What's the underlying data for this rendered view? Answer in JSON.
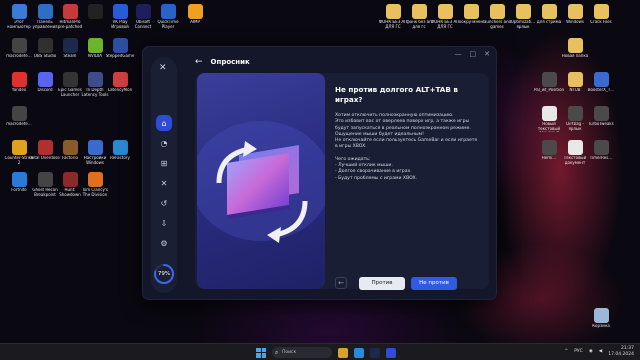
{
  "desktop": {
    "icons_left": [
      {
        "label": "Этот компьютер",
        "color": "#3b7bd8"
      },
      {
        "label": "Панель управления",
        "color": "#2d6fc4"
      },
      {
        "label": "HitmanPro pre-patched",
        "color": "#c83a3a"
      },
      {
        "label": "",
        "color": "#222"
      },
      {
        "label": "VK Play Игровой",
        "color": "#2a5bd7"
      },
      {
        "label": "Ubisoft Connect",
        "color": "#1e1e5a"
      },
      {
        "label": "QuickTime Player",
        "color": "#2a62c8"
      },
      {
        "label": "AIMP",
        "color": "#f0a020"
      },
      {
        "label": "macrodefe…",
        "color": "#444"
      },
      {
        "label": "OBS Studio",
        "color": "#303030"
      },
      {
        "label": "Steam",
        "color": "#1b2a4a"
      },
      {
        "label": "NVIDIA",
        "color": "#6cb42c"
      },
      {
        "label": "SteppedGame",
        "color": "#2e4fa0"
      },
      {
        "label": "Yandex",
        "color": "#e03030"
      },
      {
        "label": "Discord",
        "color": "#5865f2"
      },
      {
        "label": "Epic Games Launcher",
        "color": "#333"
      },
      {
        "label": "In Depth Latency Tools",
        "color": "#3d4d8a"
      },
      {
        "label": "LatencyMon",
        "color": "#d04040"
      },
      {
        "label": "macrodefe…",
        "color": "#444"
      },
      {
        "label": "Counter-Strike 2",
        "color": "#e0a020"
      },
      {
        "label": "Total Overdose",
        "color": "#b03030"
      },
      {
        "label": "Factorio",
        "color": "#8a5a2a"
      },
      {
        "label": "Настройки Windows",
        "color": "#3a6ad0"
      },
      {
        "label": "ReFactory",
        "color": "#2a8ad0"
      },
      {
        "label": "Fortnite",
        "color": "#2a7ad8"
      },
      {
        "label": "Ghost Recon Breakpoint",
        "color": "#444"
      },
      {
        "label": "Hunt: Showdown",
        "color": "#8a2a2a"
      },
      {
        "label": "Tom Clancy's The Division",
        "color": "#e07020"
      }
    ],
    "icons_right": [
      {
        "label": "ФОНК БЕЗ АП ДЛЯ ГС",
        "color": "#e8c060"
      },
      {
        "label": "фонк без ап для гс",
        "color": "#e8c060"
      },
      {
        "label": "ФОНК БЕЗ АП ДЛЯ ГС",
        "color": "#e8c060"
      },
      {
        "label": "хокру-мнен",
        "color": "#e8c060"
      },
      {
        "label": "launchers and games",
        "color": "#e8c060"
      },
      {
        "label": "Optimizati… ярлык",
        "color": "#e8c060"
      },
      {
        "label": "для стрима",
        "color": "#e8c060"
      },
      {
        "label": "Windows",
        "color": "#e8c060"
      },
      {
        "label": "Crack Files",
        "color": "#e8c060"
      },
      {
        "label": "Новая папка",
        "color": "#e8c060"
      },
      {
        "label": "Pal_wf_Position",
        "color": "#4a4a4a"
      },
      {
        "label": "NTUB",
        "color": "#e8c060"
      },
      {
        "label": "BoosterX_T…",
        "color": "#3a6ad0"
      },
      {
        "label": "Новый текстовый документ",
        "color": "#e8e8e8"
      },
      {
        "label": "Dirtbag - ярлык",
        "color": "#4a4a4a"
      },
      {
        "label": "TurboTweaks",
        "color": "#4a4a4a"
      },
      {
        "label": "Hemi…",
        "color": "#4a4a4a"
      },
      {
        "label": "Текстовый документ",
        "color": "#e8e8e8"
      },
      {
        "label": "TimerRes…",
        "color": "#4a4a4a"
      },
      {
        "label": "Корзина",
        "color": "#9ab8d8"
      }
    ]
  },
  "app": {
    "logo": "✕",
    "back_icon": "←",
    "title": "Опросник",
    "controls": [
      "—",
      "□",
      "✕"
    ],
    "progress_label": "79%",
    "progress_value": 0.79,
    "accent": "#2f5be0",
    "question": {
      "title": "Не против долгого ALT+TAB в играх?",
      "paragraphs": [
        "Хотим отключить полноэкранную оптимизацию.",
        "Это избавит вас от оверлеев поверх игр, а также игры будут запускаться в реальном полноэкранном режиме.",
        "Ощущение мыши будет идеальным!",
        "Не отключайте если пользуетесь GameBar и если играете в игры XBOX."
      ],
      "expect_title": "Чего ожидать:",
      "expect_items": [
        "- Лучший отклик мыши.",
        "- Долгое сворачивание в играх.",
        "- Будут проблемы с играми XBOX."
      ]
    },
    "buttons": {
      "prev_icon": "←",
      "yes": "Против",
      "no": "Не против"
    }
  },
  "taskbar": {
    "search_placeholder": "Поиск",
    "language": "РУС",
    "time": "21:37",
    "date": "17.04.2024"
  }
}
